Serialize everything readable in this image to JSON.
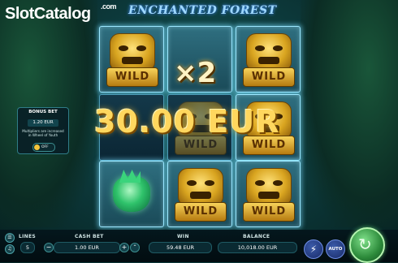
{
  "watermark": {
    "slot": "Slot",
    "catalog": "Catalog",
    "dotcom": ".com"
  },
  "game": {
    "title": "ENCHANTED FOREST"
  },
  "reels": {
    "symbol_label": "WILD",
    "multiplier": "×2",
    "win_text": "30.00 EUR"
  },
  "bonus_bet": {
    "title": "BONUS BET",
    "value": "1.20 EUR",
    "description": "Multipliers are increased in Wheel of Youth",
    "toggle_label": "OFF"
  },
  "controls": {
    "lines_label": "LINES",
    "lines_value": "5",
    "cash_bet_label": "CASH BET",
    "cash_bet_value": "1.00 EUR",
    "minus": "−",
    "plus": "+",
    "win_label": "WIN",
    "win_value": "59.48 EUR",
    "balance_label": "BALANCE",
    "balance_value": "10,018.00 EUR",
    "turbo_icon": "⚡",
    "auto_label": "AUTO",
    "spin_icon": "↻"
  },
  "icons": {
    "menu": "menu-icon",
    "sound": "sound-icon",
    "info": "info-icon",
    "fullscreen": "fullscreen-icon"
  }
}
